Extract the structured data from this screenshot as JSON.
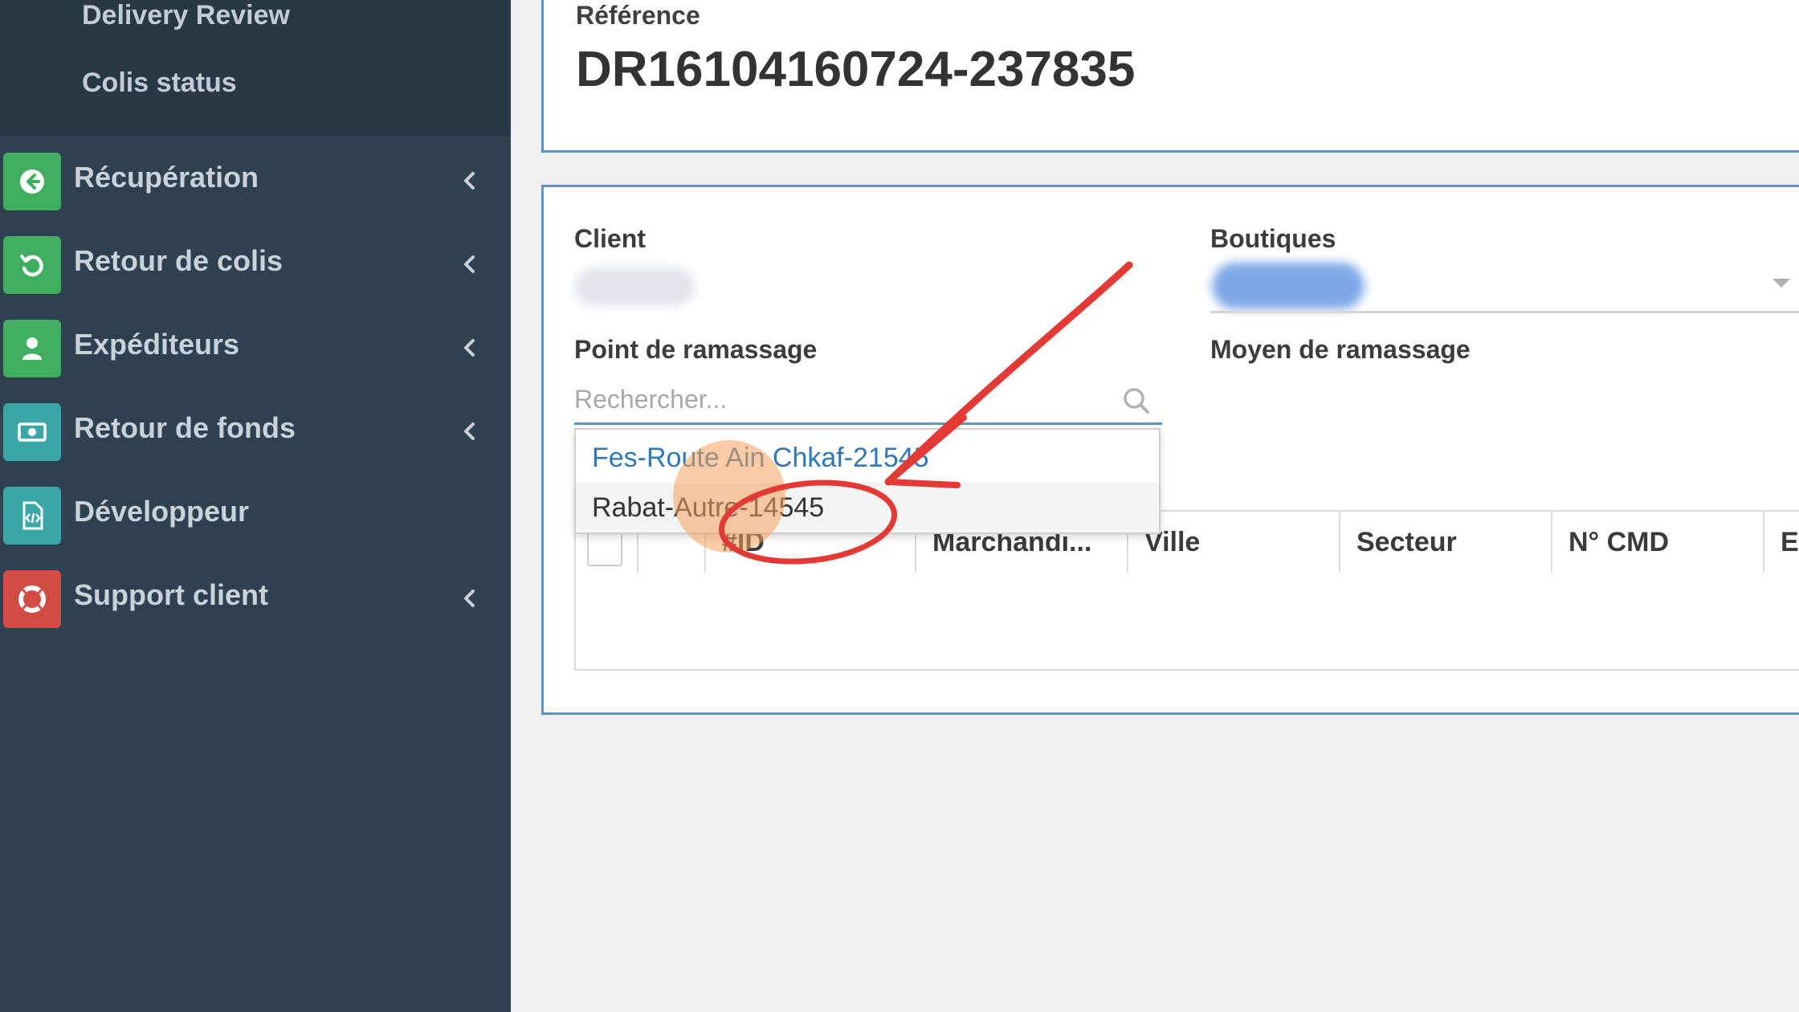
{
  "sidebar": {
    "submenu": [
      "Delivery Review",
      "Colis status"
    ],
    "items": [
      {
        "label": "Récupération",
        "icon": "arrow-circle-left-icon",
        "color": "#3fae5f",
        "has_chevron": true
      },
      {
        "label": "Retour de colis",
        "icon": "undo-icon",
        "color": "#3fae5f",
        "has_chevron": true
      },
      {
        "label": "Expéditeurs",
        "icon": "user-icon",
        "color": "#3fae5f",
        "has_chevron": true
      },
      {
        "label": "Retour de fonds",
        "icon": "money-icon",
        "color": "#3aa6a6",
        "has_chevron": true
      },
      {
        "label": "Développeur",
        "icon": "code-file-icon",
        "color": "#3aa6a6",
        "has_chevron": false
      },
      {
        "label": "Support client",
        "icon": "life-ring-icon",
        "color": "#d24c45",
        "has_chevron": true
      }
    ]
  },
  "reference": {
    "label": "Référence",
    "value": "DR16104160724-237835"
  },
  "form": {
    "client_label": "Client",
    "boutiques_label": "Boutiques",
    "pickup_point_label": "Point de ramassage",
    "pickup_method_label": "Moyen de ramassage",
    "search_placeholder": "Rechercher...",
    "dropdown_options": [
      "Fes-Route Ain Chkaf-21545",
      "Rabat-Autre-14545"
    ]
  },
  "table": {
    "columns": [
      "",
      "#ID",
      "Marchandi...",
      "Ville",
      "Secteur",
      "N° CMD",
      "Ex"
    ]
  },
  "colors": {
    "sidebar_bg": "#2f4050",
    "accent": "#5b93c7",
    "link": "#2f78b7",
    "annotation": "#e53935",
    "click_marker": "#f5a05a"
  }
}
